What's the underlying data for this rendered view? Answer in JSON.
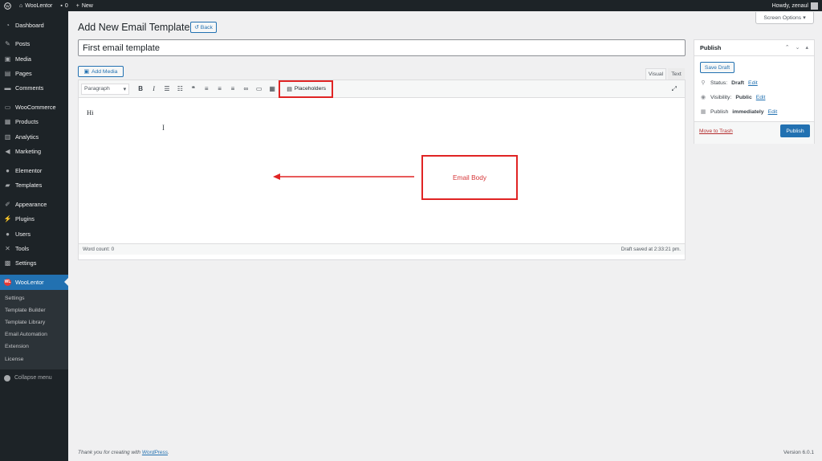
{
  "adminbar": {
    "site_name": "WooLentor",
    "comments_count": "0",
    "new_label": "New",
    "howdy": "Howdy, zenaul"
  },
  "sidebar": {
    "items": [
      {
        "label": "Dashboard",
        "icon": "dashboard-icon"
      },
      {
        "label": "Posts",
        "icon": "pin-icon"
      },
      {
        "label": "Media",
        "icon": "media-icon"
      },
      {
        "label": "Pages",
        "icon": "pages-icon"
      },
      {
        "label": "Comments",
        "icon": "comments-icon"
      },
      {
        "label": "WooCommerce",
        "icon": "woocommerce-icon"
      },
      {
        "label": "Products",
        "icon": "products-icon"
      },
      {
        "label": "Analytics",
        "icon": "analytics-icon"
      },
      {
        "label": "Marketing",
        "icon": "megaphone-icon"
      },
      {
        "label": "Elementor",
        "icon": "elementor-icon"
      },
      {
        "label": "Templates",
        "icon": "folder-icon"
      },
      {
        "label": "Appearance",
        "icon": "brush-icon"
      },
      {
        "label": "Plugins",
        "icon": "plugin-icon"
      },
      {
        "label": "Users",
        "icon": "users-icon"
      },
      {
        "label": "Tools",
        "icon": "wrench-icon"
      },
      {
        "label": "Settings",
        "icon": "settings-icon"
      },
      {
        "label": "WooLentor",
        "icon": "woolentor-icon"
      }
    ],
    "woolentor_logo_text": "WL",
    "submenu": [
      "Settings",
      "Template Builder",
      "Template Library",
      "Email Automation",
      "Extension",
      "License"
    ],
    "collapse": "Collapse menu"
  },
  "screen_options": "Screen Options",
  "header": {
    "title": "Add New Email Template",
    "back": "Back"
  },
  "title_field": {
    "value": "First email template"
  },
  "add_media": "Add Media",
  "editor": {
    "tab_visual": "Visual",
    "tab_text": "Text",
    "format": "Paragraph",
    "placeholders": "Placeholders",
    "content": "Hi",
    "word_count": "Word count: 0",
    "draft_saved": "Draft saved at 2:33:21 pm."
  },
  "annotation": {
    "label": "Email Body",
    "color": "#e02424"
  },
  "publish": {
    "heading": "Publish",
    "save_draft": "Save Draft",
    "status_label": "Status:",
    "status_value": "Draft",
    "visibility_label": "Visibility:",
    "visibility_value": "Public",
    "publish_label": "Publish",
    "publish_value": "immediately",
    "edit": "Edit",
    "move_to_trash": "Move to Trash",
    "publish_button": "Publish"
  },
  "footer": {
    "thanks": "Thank you for creating with",
    "wordpress": "WordPress",
    "period": ".",
    "version": "Version 6.0.1"
  },
  "colors": {
    "admin_dark": "#1d2327",
    "accent": "#2271b1",
    "highlight_red": "#e02424"
  }
}
